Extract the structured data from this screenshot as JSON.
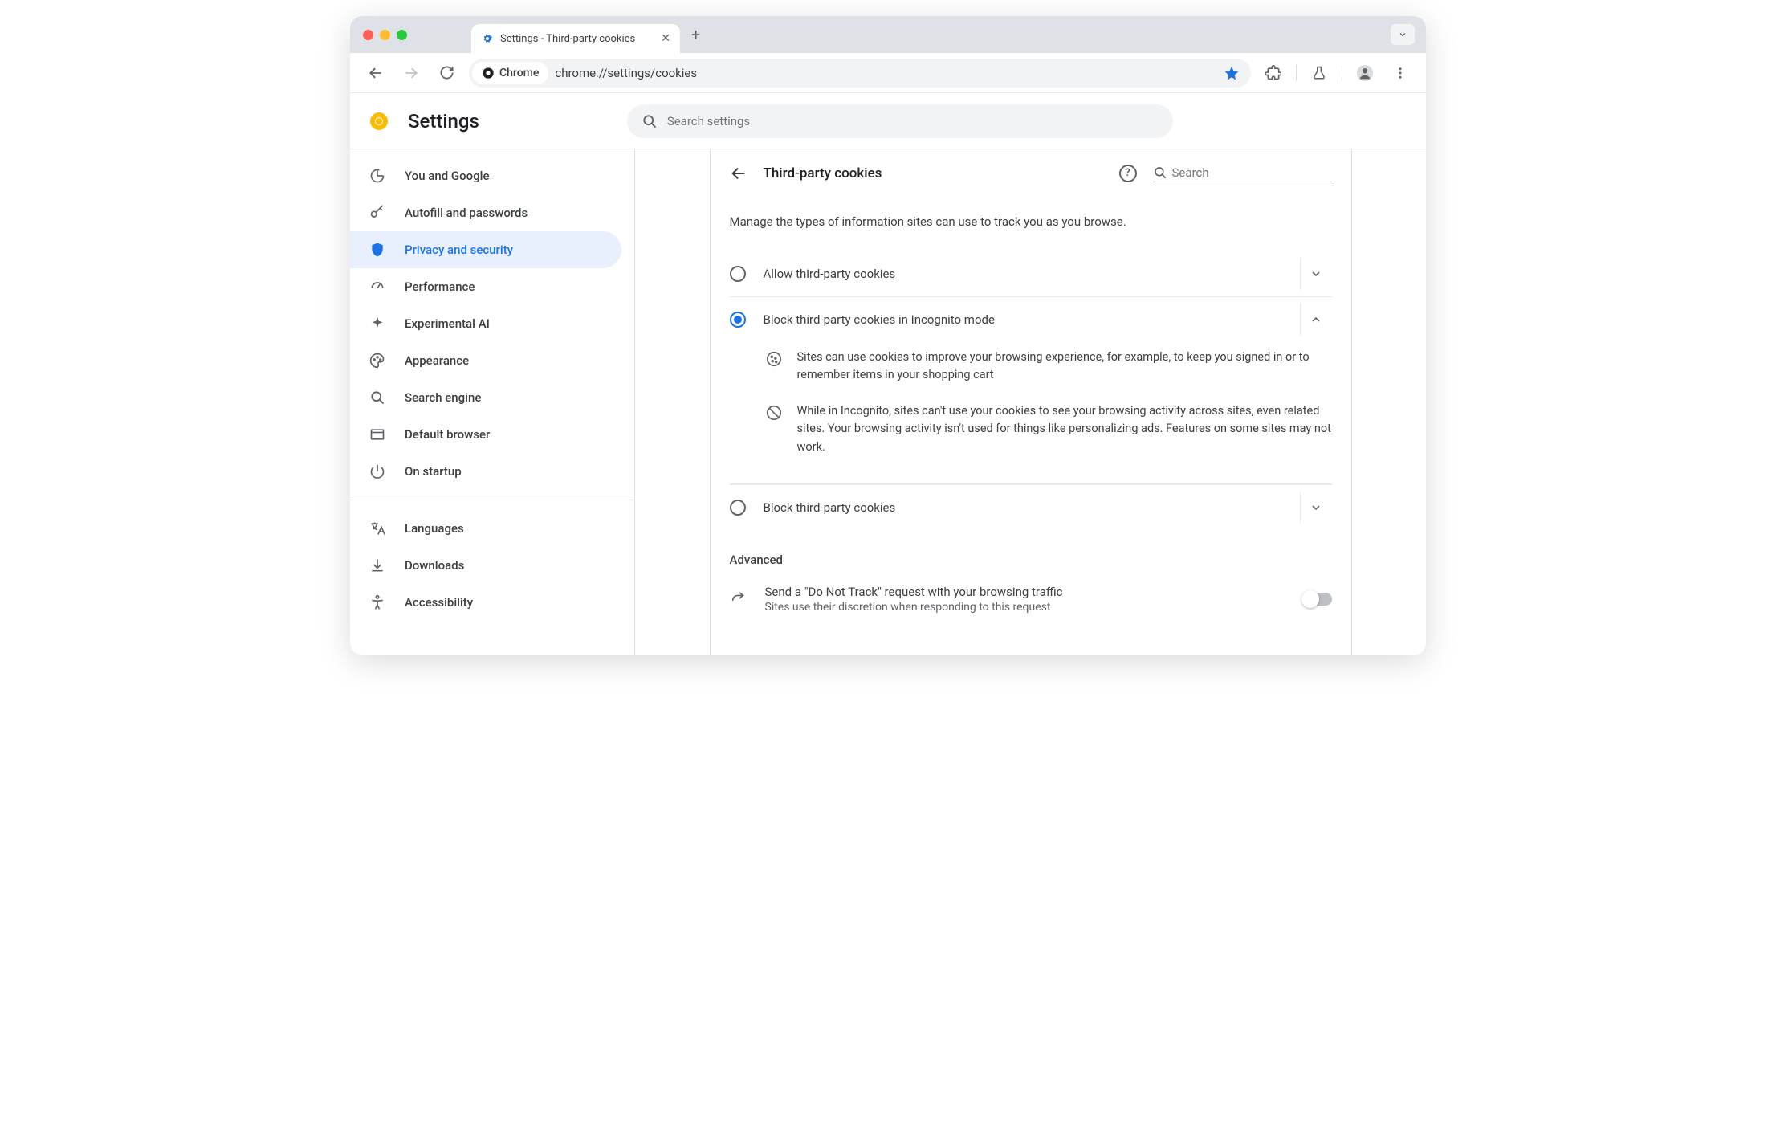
{
  "browser": {
    "tab_title": "Settings - Third-party cookies",
    "omnibox_chip": "Chrome",
    "url": "chrome://settings/cookies"
  },
  "header": {
    "title": "Settings",
    "search_placeholder": "Search settings"
  },
  "sidebar": {
    "items": [
      {
        "label": "You and Google"
      },
      {
        "label": "Autofill and passwords"
      },
      {
        "label": "Privacy and security"
      },
      {
        "label": "Performance"
      },
      {
        "label": "Experimental AI"
      },
      {
        "label": "Appearance"
      },
      {
        "label": "Search engine"
      },
      {
        "label": "Default browser"
      },
      {
        "label": "On startup"
      }
    ],
    "secondary": [
      {
        "label": "Languages"
      },
      {
        "label": "Downloads"
      },
      {
        "label": "Accessibility"
      }
    ]
  },
  "panel": {
    "title": "Third-party cookies",
    "search_placeholder": "Search",
    "description": "Manage the types of information sites can use to track you as you browse.",
    "options": [
      {
        "label": "Allow third-party cookies",
        "selected": false,
        "expanded": false
      },
      {
        "label": "Block third-party cookies in Incognito mode",
        "selected": true,
        "expanded": true,
        "details": [
          "Sites can use cookies to improve your browsing experience, for example, to keep you signed in or to remember items in your shopping cart",
          "While in Incognito, sites can't use your cookies to see your browsing activity across sites, even related sites. Your browsing activity isn't used for things like personalizing ads. Features on some sites may not work."
        ]
      },
      {
        "label": "Block third-party cookies",
        "selected": false,
        "expanded": false
      }
    ],
    "advanced_label": "Advanced",
    "dnt": {
      "title": "Send a \"Do Not Track\" request with your browsing traffic",
      "subtitle": "Sites use their discretion when responding to this request",
      "enabled": false
    }
  }
}
